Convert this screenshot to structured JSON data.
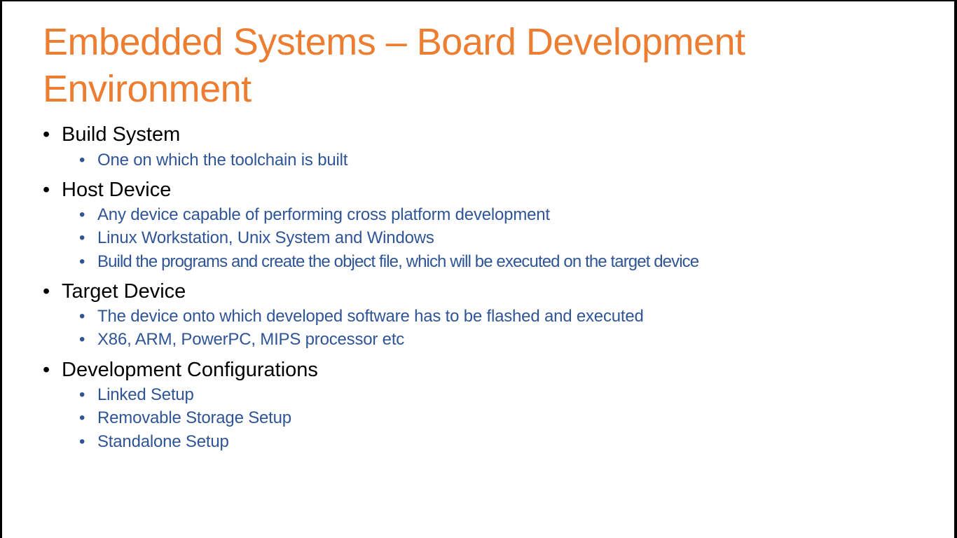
{
  "slide": {
    "title_lines": [
      "Embedded Systems – Board Development",
      "Environment"
    ],
    "colors": {
      "title": "#ED7D31",
      "level1": "#000000",
      "level2": "#2F5597"
    },
    "bullets": [
      {
        "text": "Build System",
        "children": [
          "One on which the toolchain is built"
        ]
      },
      {
        "text": "Host Device",
        "children": [
          "Any device capable of performing cross platform development",
          "Linux Workstation, Unix System and Windows",
          "Build the programs and create the object file, which will be executed on the target device"
        ]
      },
      {
        "text": "Target Device",
        "children": [
          "The device onto which developed software has to be flashed and executed",
          "X86, ARM, PowerPC, MIPS processor etc"
        ]
      },
      {
        "text": "Development Configurations",
        "children": [
          "Linked Setup",
          "Removable Storage Setup",
          "Standalone Setup"
        ]
      }
    ],
    "bullet_glyph": "•"
  }
}
